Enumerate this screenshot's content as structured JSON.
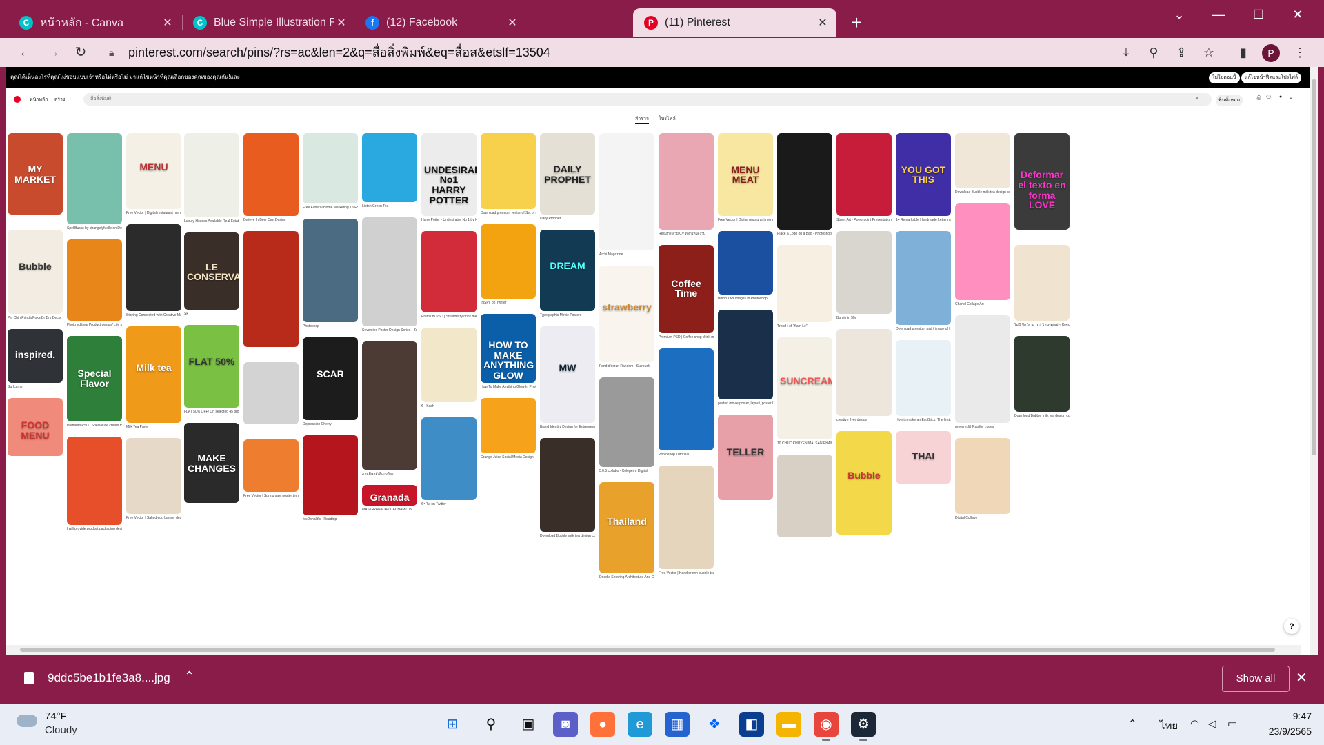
{
  "browser": {
    "tabs": [
      {
        "label": "หน้าหลัก - Canva",
        "icon": "canva-icon",
        "color": "#00c4cc",
        "active": false
      },
      {
        "label": "Blue Simple Illustration Romance",
        "icon": "canva-icon",
        "color": "#00c4cc",
        "active": false
      },
      {
        "label": "(12) Facebook",
        "icon": "facebook-icon",
        "color": "#1877f2",
        "active": false
      },
      {
        "label": "(11) Pinterest",
        "icon": "pinterest-icon",
        "color": "#e60023",
        "active": true
      }
    ],
    "new_tab": "+",
    "url": "pinterest.com/search/pins/?rs=ac&len=2&q=สื่อสิ่งพิมพ์&eq=สื่อส&etslf=13504",
    "profile_initial": "P",
    "accent_color": "#8a1c4a"
  },
  "pinterest": {
    "banner_text": "คุณได้เห็นอะไรที่คุณไม่ชอบแบบเจ้าหรือไม่หรือไม่ มาแก้ไขหน้าที่คุณเลือกของคุณของคุณกัน!และ",
    "banner_buttons": [
      "ไม่ใช่ตอนนี้",
      "แก้ไขหน้าฟีดและโปรไฟล์"
    ],
    "header": {
      "home": "หน้าหลัก",
      "create": "สร้าง",
      "search_query": "สื่อสิ่งพิมพ์",
      "filter": "พินทั้งหมด"
    },
    "nav": {
      "tab1": "สำรวจ",
      "tab2": "โปรไฟล์"
    }
  },
  "pins": [
    {
      "title": "MY MARKET",
      "caption": ""
    },
    {
      "title": "",
      "caption": "SpellBucks by strangelyfuelle on DeviantArt"
    },
    {
      "title": "MENU",
      "caption": "Free Vector | Digital restaurant menu template theme"
    },
    {
      "title": "",
      "caption": "Luxury Houses Available Real Estate Flyers | PSD Free Downloa..."
    },
    {
      "title": "",
      "caption": "Believe In Beer Can Design"
    },
    {
      "title": "",
      "caption": "Free Funeral Home Marketing Tri-Fold Brochure Template"
    },
    {
      "title": "",
      "caption": "Lipton Green Tea"
    },
    {
      "title": "UNDESIRABLE No1 HARRY POTTER",
      "caption": "Harry Potter - Undesirable No 1 by Kane2000 on DeviantArt"
    },
    {
      "title": "",
      "caption": "Download premium vector of Set of minimal Memphis design start..."
    },
    {
      "title": "DAILY PROPHET",
      "caption": "Daily Prophet"
    },
    {
      "title": "",
      "caption": "Archi Magazine"
    },
    {
      "title": "",
      "caption": "Resume สวย CV ที่ทำให้ได้งาน"
    },
    {
      "title": "MENU MEAT",
      "caption": "Free Vector | Digital restaurant menu design"
    },
    {
      "title": "",
      "caption": "Place a Logo on a Bag - Photoshop Tutorial"
    },
    {
      "title": "",
      "caption": "Street Art - Powerpoint Presentation Template"
    },
    {
      "title": "YOU GOT THIS",
      "caption": "14 Remarkable Handmade Lettering and Typography Design..."
    },
    {
      "title": "",
      "caption": "Download Bubble milk tea design collection,Pearl milk tea , Boba..."
    },
    {
      "title": "Deformar el texto en forma LOVE",
      "caption": ""
    },
    {
      "title": "Bubble",
      "caption": "Pin Chih Prinda Poka Dr Dry Decor Ideas ESC"
    },
    {
      "title": "",
      "caption": "Photo editing/ Product design/ Life style design/Product photo..."
    },
    {
      "title": "",
      "caption": "Staying Connected with Creative Marketing Kits - Firstline Printing"
    },
    {
      "title": "LE CONSERVATOIRE",
      "caption": "Sk"
    },
    {
      "title": "",
      "caption": ""
    },
    {
      "title": "",
      "caption": "Photoshop"
    },
    {
      "title": "",
      "caption": "Seventies Poster Design Series - Zeka Design"
    },
    {
      "title": "",
      "caption": "Premium PSD | Strawberry drink menu social media post templat..."
    },
    {
      "title": "",
      "caption": "INSPI. on Twitter"
    },
    {
      "title": "DREAM",
      "caption": "Typographic Movie Posters"
    },
    {
      "title": "strawberry",
      "caption": "Fond d'écran Random - Starbuck"
    },
    {
      "title": "Coffee Time",
      "caption": "Premium PSD | Coffee shop drink menu promotion social media..."
    },
    {
      "title": "",
      "caption": "Blend Two Images in Photoshop"
    },
    {
      "title": "",
      "caption": "Trend+ of \"Kam Le\""
    },
    {
      "title": "",
      "caption": "Burnie in 50s"
    },
    {
      "title": "",
      "caption": "Download premium psd / image of Hand drawn sweet waffles mock..."
    },
    {
      "title": "",
      "caption": "Chanel Collage Art"
    },
    {
      "title": "",
      "caption": "ไม่มี ชื่อ (สามารถ) ไหนๆดูกเย่ ๆ Keeo"
    },
    {
      "title": "inspired.",
      "caption": "Surfcamp"
    },
    {
      "title": "Special Flavor",
      "caption": "Premium PSD | Special ice cream menu promotion social media..."
    },
    {
      "title": "Milk tea",
      "caption": "Milk Tea Party"
    },
    {
      "title": "FLAT 50%",
      "caption": "FLAT 50% OFF! On selected 45 products of brands"
    },
    {
      "title": "",
      "caption": ""
    },
    {
      "title": "SCAR",
      "caption": "Depression Cherry"
    },
    {
      "title": "",
      "caption": "ภาพพื้นหลังสีแกงห้อง"
    },
    {
      "title": "",
      "caption": "ทิ | Kush"
    },
    {
      "title": "HOW TO MAKE ANYTHING GLOW",
      "caption": "How To Make Anything Glow In Photoshop"
    },
    {
      "title": "MW",
      "caption": "Brand Identity Design for Entrepreneurs and Businesses..."
    },
    {
      "title": "",
      "caption": "5:0:5 collabo - Coleperm Digital"
    },
    {
      "title": "",
      "caption": "Photoshop Tutorials"
    },
    {
      "title": "",
      "caption": "poster, movie poster, layout, poster layout, and poster prints image..."
    },
    {
      "title": "SUNCREAM",
      "caption": "10 CHỤC KHUYẾN MẠI SAN PHẨM Ở SHOP NHỮ THẾ NÀO ĐỂ..."
    },
    {
      "title": "",
      "caption": "creative flyer design"
    },
    {
      "title": "",
      "caption": "How to make an EcoBrick: The first step in eliminating non-recyclab..."
    },
    {
      "title": "",
      "caption": "green edithRapillel Lopes"
    },
    {
      "title": "",
      "caption": "Download Bubble milk tea design collection,Pearl milk tea , Boba..."
    },
    {
      "title": "FOOD MENU",
      "caption": ""
    },
    {
      "title": "",
      "caption": "I will provide product packaging designs professionally"
    },
    {
      "title": "",
      "caption": "Free Vector | Salted egg banner design with croissant, crepe cake..."
    },
    {
      "title": "MAKE CHANGES",
      "caption": ""
    },
    {
      "title": "",
      "caption": "Free Vector | Spring sale poster template on orange background"
    },
    {
      "title": "",
      "caption": "McDonald's - Roadtrip"
    },
    {
      "title": "Granada",
      "caption": "MAS GRANADA / CACHAMTUN"
    },
    {
      "title": "",
      "caption": "ทีๆ ไอ on Twitter"
    },
    {
      "title": "",
      "caption": "Orange Juice Social Media Design"
    },
    {
      "title": "",
      "caption": "Download Bubble milk tea design collection,Pearl milk tea , Boba..."
    },
    {
      "title": "Thailand",
      "caption": "Doodle Showing Architecture And Culture Of Thailand Stock Vector..."
    },
    {
      "title": "",
      "caption": "Free Vector | Hand drawn bubble tea flavors set"
    },
    {
      "title": "TELLER",
      "caption": ""
    },
    {
      "title": "",
      "caption": ""
    },
    {
      "title": "Bubble",
      "caption": ""
    },
    {
      "title": "THAI",
      "caption": ""
    },
    {
      "title": "",
      "caption": "Digital Collage"
    }
  ],
  "downloads": {
    "file_name": "9ddc5be1b1fe3a8....jpg",
    "show_all": "Show all"
  },
  "taskbar": {
    "temperature": "74°F",
    "condition": "Cloudy",
    "language": "ไทย",
    "time": "9:47",
    "date": "23/9/2565"
  }
}
